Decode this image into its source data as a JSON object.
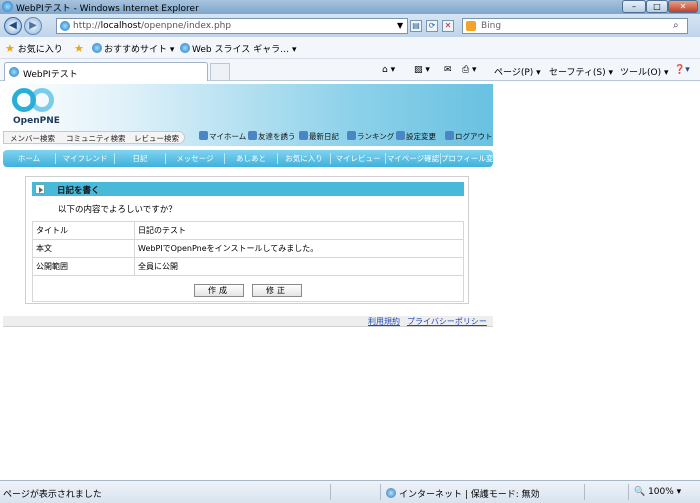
{
  "window": {
    "title": "WebPIテスト - Windows Internet Explorer",
    "minimize": "–",
    "maximize": "□",
    "close": "✕"
  },
  "addressbar": {
    "url_prefix": "http://",
    "url_host": "localhost",
    "url_path": "/openpne/index.php",
    "search_placeholder": "Bing"
  },
  "favorites": {
    "favorites_label": "お気に入り",
    "suggested_sites": "おすすめサイト",
    "web_slice": "Web スライス ギャラ…"
  },
  "tab": {
    "title": "WebPIテスト"
  },
  "commandbar": {
    "page": "ページ(P)",
    "safety": "セーフティ(S)",
    "tools": "ツール(O)"
  },
  "site": {
    "logo_text": "OpenPNE",
    "search_links": [
      "メンバー検索",
      "コミュニティ検索",
      "レビュー検索"
    ],
    "user_links": [
      "マイホーム",
      "友達を誘う",
      "最新日記",
      "ランキング",
      "設定変更",
      "ログアウト"
    ],
    "menu": [
      "ホーム",
      "マイフレンド",
      "日記",
      "メッセージ",
      "あしあと",
      "お気に入り",
      "マイレビュー",
      "マイページ確認",
      "プロフィール変更"
    ]
  },
  "confirm": {
    "heading": "日記を書く",
    "question": "以下の内容でよろしいですか？",
    "rows": [
      {
        "label": "タイトル",
        "value": "日記のテスト"
      },
      {
        "label": "本文",
        "value": "WebPIでOpenPneをインストールしてみました。"
      },
      {
        "label": "公開範囲",
        "value": "全員に公開"
      }
    ],
    "submit_button": "作成",
    "edit_button": "修正"
  },
  "footer": {
    "terms": "利用規約",
    "privacy": "プライバシーポリシー"
  },
  "status": {
    "message": "ページが表示されました",
    "zone": "インターネット | 保護モード: 無効",
    "zoom": "100%"
  }
}
